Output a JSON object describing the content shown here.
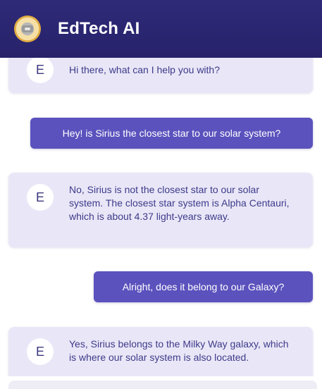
{
  "app": {
    "title": "EdTech AI"
  },
  "messages": [
    {
      "role": "bot",
      "avatar": "E",
      "text": "Hi there, what can I help you with?"
    },
    {
      "role": "user",
      "text": "Hey! is Sirius the closest star to our solar system?"
    },
    {
      "role": "bot",
      "avatar": "E",
      "text": "No, Sirius is not the closest star to our solar system. The closest star system is Alpha Centauri, which is about 4.37 light-years away."
    },
    {
      "role": "user",
      "text": "Alright, does it belong to our Galaxy?"
    },
    {
      "role": "bot",
      "avatar": "E",
      "text": "Yes, Sirius belongs to the Milky Way galaxy, which is where our solar system is also located."
    }
  ],
  "colors": {
    "header": "#2f2a78",
    "bot_bubble": "#e9e7f7",
    "user_bubble": "#5b52bd",
    "bot_text": "#3d3a8a"
  }
}
